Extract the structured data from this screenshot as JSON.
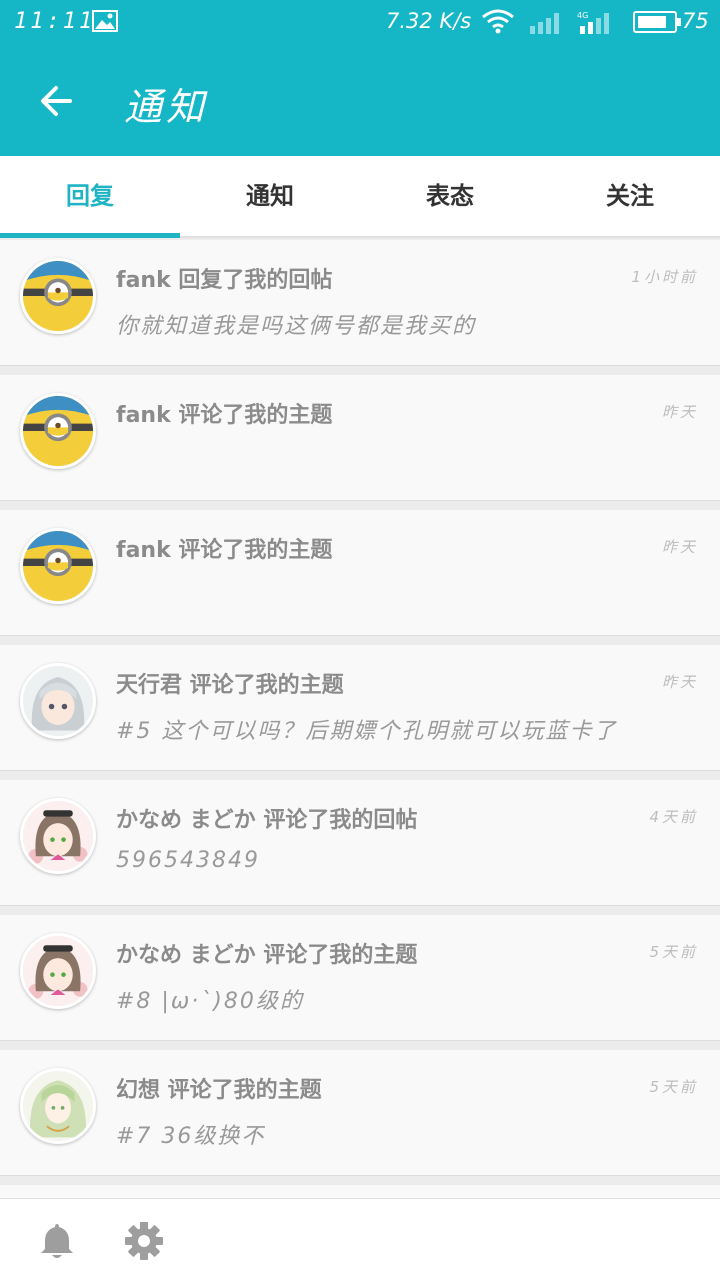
{
  "status_bar": {
    "time": "11:11",
    "speed": "7.32 K/s",
    "network": "4G",
    "battery": "75"
  },
  "header": {
    "title": "通知"
  },
  "tabs": [
    {
      "label": "回复",
      "active": true
    },
    {
      "label": "通知",
      "active": false
    },
    {
      "label": "表态",
      "active": false
    },
    {
      "label": "关注",
      "active": false
    }
  ],
  "notifications": [
    {
      "title": "fank 回复了我的回帖",
      "time": "1小时前",
      "body": "你就知道我是吗这俩号都是我买的",
      "avatar": "minion"
    },
    {
      "title": "fank 评论了我的主题",
      "time": "昨天",
      "body": "",
      "avatar": "minion"
    },
    {
      "title": "fank 评论了我的主题",
      "time": "昨天",
      "body": "",
      "avatar": "minion"
    },
    {
      "title": "天行君 评论了我的主题",
      "time": "昨天",
      "body": "#5 这个可以吗？后期嫖个孔明就可以玩蓝卡了",
      "avatar": "anime-silver-hair"
    },
    {
      "title": "かなめ まどか 评论了我的回帖",
      "time": "4天前",
      "body": "596543849",
      "avatar": "anime-brown-hair"
    },
    {
      "title": "かなめ まどか 评论了我的主题",
      "time": "5天前",
      "body": "#8 |ω·`)80级的",
      "avatar": "anime-brown-hair"
    },
    {
      "title": "幻想 评论了我的主题",
      "time": "5天前",
      "body": "#7 36级换不",
      "avatar": "anime-green-hair"
    }
  ],
  "colors": {
    "primary": "#15b7c6",
    "tab_active": "#1fb3c4",
    "title_text": "#8b8b8b",
    "time_text": "#bdbdbd"
  },
  "bottom_bar": {
    "icons": [
      "bell-icon",
      "gear-icon"
    ]
  }
}
